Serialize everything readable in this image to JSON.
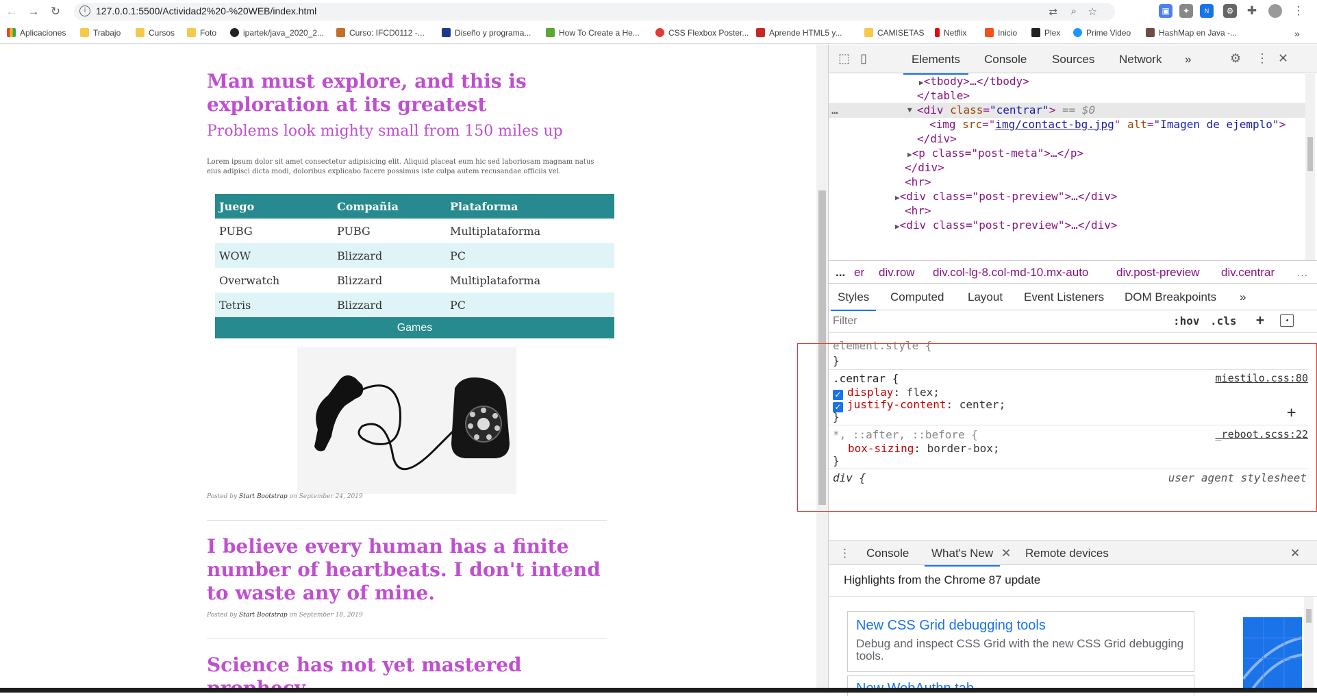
{
  "browser": {
    "url": "127.0.0.1:5500/Actividad2%20-%20WEB/index.html"
  },
  "bookmarks": [
    {
      "label": "Aplicaciones",
      "icon": "apps-grid-icon"
    },
    {
      "label": "Trabajo",
      "icon": "folder-icon"
    },
    {
      "label": "Cursos",
      "icon": "folder-icon"
    },
    {
      "label": "Foto",
      "icon": "folder-icon"
    },
    {
      "label": "ipartek/java_2020_2...",
      "icon": "github-icon"
    },
    {
      "label": "Curso: IFCD0112 -...",
      "icon": "site-icon"
    },
    {
      "label": "Diseño y programa...",
      "icon": "site-icon"
    },
    {
      "label": "How To Create a He...",
      "icon": "site-icon"
    },
    {
      "label": "CSS Flexbox Poster...",
      "icon": "site-icon"
    },
    {
      "label": "Aprende HTML5 y...",
      "icon": "site-icon"
    },
    {
      "label": "CAMISETAS",
      "icon": "folder-icon"
    },
    {
      "label": "Netflix",
      "icon": "netflix-icon"
    },
    {
      "label": "Inicio",
      "icon": "site-icon"
    },
    {
      "label": "Plex",
      "icon": "plex-icon"
    },
    {
      "label": "Prime Video",
      "icon": "prime-icon"
    },
    {
      "label": "HashMap en Java -...",
      "icon": "site-icon"
    }
  ],
  "page": {
    "post1": {
      "title": "Man must explore, and this is exploration at its greatest",
      "subtitle": "Problems look mighty small from 150 miles up",
      "lorem": "Lorem ipsum dolor sit amet consectetur adipisicing elit. Aliquid placeat eum hic sed laboriosam magnam natus eius adipisci dicta modi, doloribus explicabo facere possimus iste culpa autem recusandae officiis vel.",
      "meta_prefix": "Posted by",
      "meta_author": "Start Bootstrap",
      "meta_suffix": "on September 24, 2019"
    },
    "table": {
      "headers": [
        "Juego",
        "Compañia",
        "Plataforma"
      ],
      "rows": [
        [
          "PUBG",
          "PUBG",
          "Multiplataforma"
        ],
        [
          "WOW",
          "Blizzard",
          "PC"
        ],
        [
          "Overwatch",
          "Blizzard",
          "Multiplataforma"
        ],
        [
          "Tetris",
          "Blizzard",
          "PC"
        ]
      ],
      "footer": "Games"
    },
    "post2": {
      "title": "I believe every human has a finite number of heartbeats. I don't intend to waste any of mine.",
      "meta_prefix": "Posted by",
      "meta_author": "Start Bootstrap",
      "meta_suffix": "on September 18, 2019"
    },
    "post3": {
      "title": "Science has not yet mastered prophecy"
    }
  },
  "devtools": {
    "tabs": [
      "Elements",
      "Console",
      "Sources",
      "Network"
    ],
    "more": "»",
    "dom": {
      "tbody": "<tbody>…</tbody>",
      "table_close": "</table>",
      "div_open_tag": "<div",
      "div_attr": "class",
      "div_val": "\"centrar\"",
      "div_end": ">",
      "selected_marker": "== $0",
      "img_tag": "<img",
      "img_src_attr": "src",
      "img_src_val": "img/contact-bg.jpg",
      "img_alt_attr": "alt",
      "img_alt_val": "\"Imagen de ejemplo\"",
      "img_end": ">",
      "div_close": "</div>",
      "p_meta": "<p class=\"post-meta\">…</p>",
      "div_close2": "</div>",
      "hr1": "<hr>",
      "post_preview1": "<div class=\"post-preview\">…</div>",
      "hr2": "<hr>",
      "post_preview2": "<div class=\"post-preview\">…</div>",
      "ellipsis": "…"
    },
    "breadcrumbs": [
      "...",
      "er",
      "div.row",
      "div.col-lg-8.col-md-10.mx-auto",
      "div.post-preview",
      "div.centrar",
      "…"
    ],
    "subtabs": [
      "Styles",
      "Computed",
      "Layout",
      "Event Listeners",
      "DOM Breakpoints",
      "»"
    ],
    "filter": {
      "placeholder": "Filter",
      "hov": ":hov",
      "cls": ".cls",
      "plus": "+"
    },
    "styles": {
      "element_style": "element.style {",
      "close1": "}",
      "centrar_sel": ".centrar {",
      "centrar_src": "miestilo.css:80",
      "p1_name": "display",
      "p1_val": "flex;",
      "p2_name": "justify-content",
      "p2_val": "center;",
      "close2": "}",
      "universal_sel": "*, ::after, ::before {",
      "universal_src": "_reboot.scss:22",
      "p3_name": "box-sizing",
      "p3_val": "border-box;",
      "close3": "}",
      "div_sel": "div {",
      "div_src": "user agent stylesheet"
    },
    "drawer": {
      "tabs": [
        "Console",
        "What's New",
        "Remote devices"
      ],
      "highlights": "Highlights from the Chrome 87 update",
      "card1_title": "New CSS Grid debugging tools",
      "card1_desc": "Debug and inspect CSS Grid with the new CSS Grid debugging tools.",
      "card2_title": "New WebAuthn tab"
    }
  },
  "colors": {
    "accent": "#c04fd0",
    "table_header": "#268a8e",
    "table_alt": "#dff4f6",
    "devtools_blue": "#1a73e8",
    "highlight_box": "#e53935"
  }
}
